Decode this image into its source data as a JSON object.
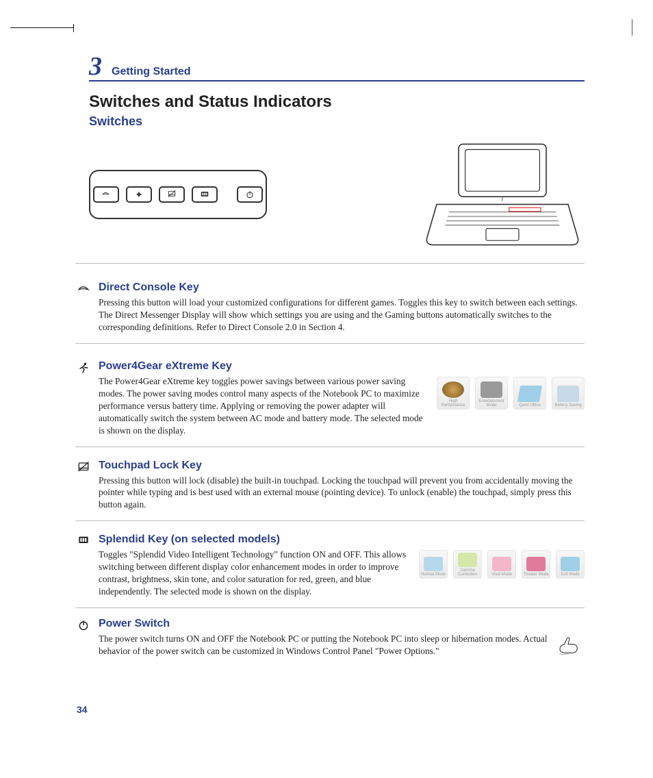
{
  "chapter": {
    "number": "3",
    "title": "Getting Started"
  },
  "page_title": "Switches and Status Indicators",
  "sub_title": "Switches",
  "sections": [
    {
      "icon": "rog",
      "title": "Direct Console Key",
      "text": "Pressing this button will load your customized configurations for different games. Toggles this key to switch between each settings. The Direct Messenger Display will show which settings you are using and the Gaming buttons automatically switches to the corresponding definitions. Refer to Direct Console 2.0 in Section 4."
    },
    {
      "icon": "runner",
      "title": "Power4Gear eXtreme Key",
      "text": "The Power4Gear eXtreme key toggles power savings between various power saving modes. The power saving modes control many aspects of the Notebook PC to maximize performance versus battery time. Applying or removing the power adapter will automatically switch the system between AC mode and battery mode. The selected mode is shown on the display.",
      "thumbs": [
        {
          "label": "High Performance",
          "color": "#d4a255"
        },
        {
          "label": "Entertainment Mode",
          "color": "#9a9a9a"
        },
        {
          "label": "Quiet Office",
          "color": "#9fcfe8"
        },
        {
          "label": "Battery Saving",
          "color": "#c7d9e6"
        }
      ]
    },
    {
      "icon": "touchpad",
      "title": "Touchpad Lock Key",
      "text": "Pressing this button will lock (disable) the built-in touchpad. Locking the touchpad will prevent you from accidentally moving the pointer while typing and is best used with an external mouse (pointing device). To unlock (enable) the touchpad, simply press this button again."
    },
    {
      "icon": "splendid",
      "title": "Splendid Key (on selected models)",
      "text": "Toggles \"Splendid Video Intelligent Technology\" function ON and OFF. This allows switching between different display color enhancement modes in order to improve contrast, brightness, skin tone, and color saturation for red, green, and blue independently. The selected mode is shown on the display.",
      "thumbs": [
        {
          "label": "Normal Mode",
          "color": "#b6d8ec"
        },
        {
          "label": "Gamma Correction",
          "color": "#d7e7aa"
        },
        {
          "label": "Vivid Mode",
          "color": "#f3b7c9"
        },
        {
          "label": "Theater Mode",
          "color": "#e07a9a"
        },
        {
          "label": "Soft Mode",
          "color": "#9fcfe8"
        }
      ]
    },
    {
      "icon": "power",
      "title": "Power Switch",
      "text": "The power switch turns ON and OFF the Notebook PC or putting the Notebook PC into sleep or hibernation modes. Actual behavior of the power switch can be customized in Windows Control Panel \"Power Options.\""
    }
  ],
  "page_number": "34"
}
